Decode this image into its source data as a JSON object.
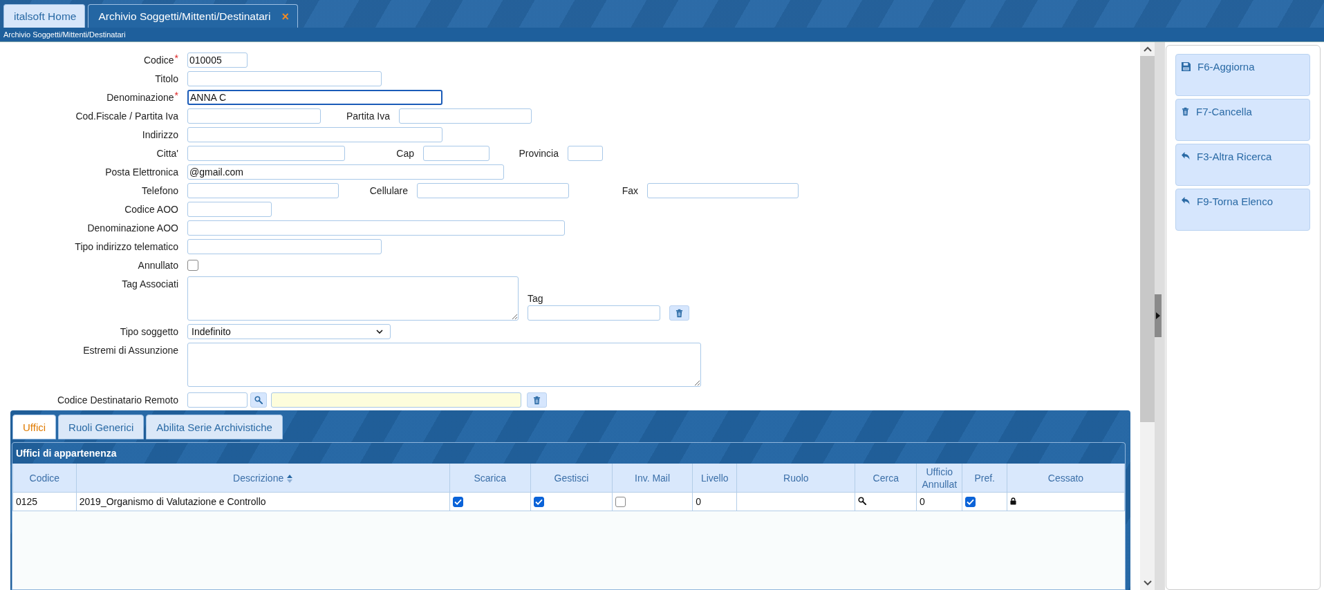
{
  "tabs": [
    {
      "label": "italsoft Home",
      "selected": false
    },
    {
      "label": "Archivio Soggetti/Mittenti/Destinatari",
      "selected": true,
      "close_glyph": "×"
    }
  ],
  "breadcrumb": "Archivio Soggetti/Mittenti/Destinatari",
  "form": {
    "rows": [
      {
        "label": "Codice",
        "required_mark": "*",
        "fields": [
          {
            "kind": "input",
            "value": "010005",
            "focused": false
          }
        ]
      },
      {
        "label": "Titolo",
        "fields": [
          {
            "kind": "input",
            "focused": false
          }
        ]
      },
      {
        "label": "Denominazione",
        "required_mark": "*",
        "fields": [
          {
            "kind": "input",
            "value": "ANNA C",
            "focused": true
          }
        ]
      },
      {
        "label": "Cod.Fiscale / Partita Iva",
        "fields": [
          {
            "kind": "input",
            "focused": false
          },
          {
            "kind": "input",
            "label": "Partita Iva",
            "focused": false
          }
        ]
      },
      {
        "label": "Indirizzo",
        "fields": [
          {
            "kind": "input",
            "focused": false
          }
        ]
      },
      {
        "label": "Citta'",
        "fields": [
          {
            "kind": "input",
            "focused": false
          },
          {
            "kind": "input",
            "label": "Cap",
            "focused": false
          },
          {
            "kind": "input",
            "label": "Provincia",
            "focused": false
          }
        ]
      },
      {
        "label": "Posta Elettronica",
        "fields": [
          {
            "kind": "input",
            "value": "@gmail.com",
            "focused": false
          }
        ]
      },
      {
        "label": "Telefono",
        "fields": [
          {
            "kind": "input",
            "focused": false
          },
          {
            "kind": "input",
            "label": "Cellulare",
            "focused": false
          },
          {
            "kind": "input",
            "label": "Fax",
            "focused": false
          }
        ]
      },
      {
        "label": "Codice AOO",
        "fields": [
          {
            "kind": "input",
            "focused": false
          }
        ]
      },
      {
        "label": "Denominazione AOO",
        "fields": [
          {
            "kind": "input",
            "focused": false
          }
        ]
      },
      {
        "label": "Tipo indirizzo telematico",
        "fields": [
          {
            "kind": "input",
            "focused": false
          }
        ]
      },
      {
        "label": "Annullato",
        "fields": [
          {
            "kind": "checkbox",
            "checked": false
          }
        ]
      },
      {
        "label": "Tag Associati",
        "fields": [
          {
            "kind": "textarea"
          },
          {
            "kind": "tag-input",
            "label": "Tag"
          },
          {
            "kind": "trash-button"
          }
        ]
      },
      {
        "label": "Tipo soggetto",
        "fields": [
          {
            "kind": "select",
            "value": "Indefinito"
          }
        ]
      },
      {
        "label": "Estremi di Assunzione",
        "fields": [
          {
            "kind": "textarea"
          }
        ]
      },
      {
        "label": "Codice Destinatario Remoto",
        "fields": [
          {
            "kind": "input",
            "focused": false
          },
          {
            "kind": "search-button"
          },
          {
            "kind": "readonly-input"
          },
          {
            "kind": "trash-button"
          }
        ]
      }
    ]
  },
  "detail_tabs": [
    {
      "label": "Uffici",
      "selected": true
    },
    {
      "label": "Ruoli Generici",
      "selected": false
    },
    {
      "label": "Abilita Serie Archivistiche",
      "selected": false
    }
  ],
  "grid": {
    "title": "Uffici di appartenenza",
    "columns": [
      {
        "label": "Codice",
        "sortable": false
      },
      {
        "label": "Descrizione",
        "sortable": true
      },
      {
        "label": "Scarica",
        "sortable": false
      },
      {
        "label": "Gestisci",
        "sortable": false
      },
      {
        "label": "Inv. Mail",
        "sortable": false
      },
      {
        "label": "Livello",
        "sortable": false
      },
      {
        "label": "Ruolo",
        "sortable": false
      },
      {
        "label": "Cerca",
        "sortable": false
      },
      {
        "label": "Ufficio Annullat",
        "sortable": false
      },
      {
        "label": "Pref.",
        "sortable": false
      },
      {
        "label": "Cessato",
        "sortable": false
      }
    ],
    "rows": [
      {
        "cells": [
          {
            "kind": "text",
            "text": "0125"
          },
          {
            "kind": "text",
            "text": "2019_Organismo di Valutazione e Controllo"
          },
          {
            "kind": "checkbox",
            "checked": true
          },
          {
            "kind": "checkbox",
            "checked": true
          },
          {
            "kind": "checkbox",
            "checked": false
          },
          {
            "kind": "text",
            "text": "0"
          },
          {
            "kind": "empty"
          },
          {
            "kind": "search"
          },
          {
            "kind": "text",
            "text": "0"
          },
          {
            "kind": "checkbox",
            "checked": true
          },
          {
            "kind": "lock"
          }
        ]
      }
    ]
  },
  "actions": [
    {
      "label": "F6-Aggiorna",
      "kind": "save"
    },
    {
      "label": "F7-Cancella",
      "kind": "trash"
    },
    {
      "label": "F3-Altra Ricerca",
      "kind": "back"
    },
    {
      "label": "F9-Torna Elenco",
      "kind": "back"
    }
  ]
}
